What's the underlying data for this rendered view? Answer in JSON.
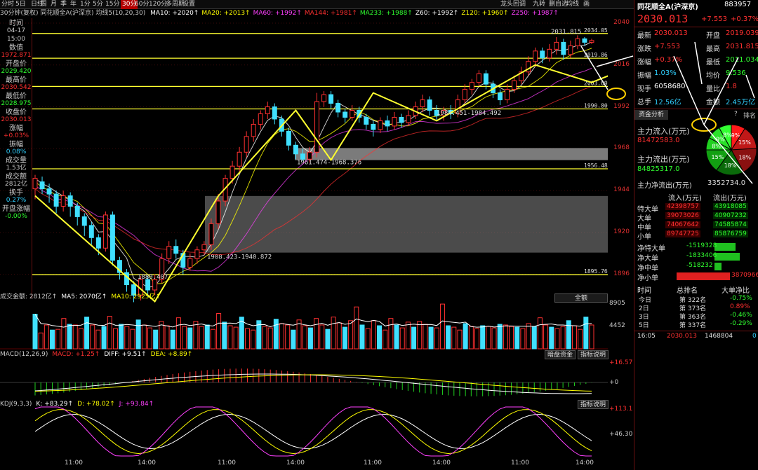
{
  "toolbar": {
    "items": [
      {
        "label": "分时",
        "active": false
      },
      {
        "label": "5日",
        "active": false
      },
      {
        "label": "日线",
        "active": false
      },
      {
        "label": "周",
        "active": false
      },
      {
        "label": "月",
        "active": false
      },
      {
        "label": "季",
        "active": false
      },
      {
        "label": "年",
        "active": false
      },
      {
        "label": "1分",
        "active": false
      },
      {
        "label": "5分",
        "active": false
      },
      {
        "label": "15分",
        "active": false
      },
      {
        "label": "30分",
        "active": true
      },
      {
        "label": "60分",
        "active": false
      },
      {
        "label": "120分",
        "active": false
      },
      {
        "label": "多周期",
        "active": false
      },
      {
        "label": "设置",
        "active": false
      }
    ],
    "right_items": [
      "龙头回调",
      "九转",
      "删自选",
      "均线",
      "画"
    ]
  },
  "ma_legend": {
    "title": "30分钟(复权) 同花顺全A(沪深京) 均线5(10,20,30)",
    "items": [
      {
        "text": "MA10: +2020↑",
        "color": "#ffffff"
      },
      {
        "text": "MA20: +2013↑",
        "color": "#ffff00"
      },
      {
        "text": "MA60: +1992↑",
        "color": "#ff40ff"
      },
      {
        "text": "MA144: +1981↑",
        "color": "#ff3030"
      },
      {
        "text": "MA233: +1988↑",
        "color": "#30ff30"
      },
      {
        "text": "Z60: +1992↑",
        "color": "#ffffff"
      },
      {
        "text": "Z120: +1960↑",
        "color": "#ffff00"
      },
      {
        "text": "Z250: +1987↑",
        "color": "#ff40ff"
      }
    ]
  },
  "left_panel": [
    {
      "label": "时间",
      "value": "04-17",
      "color": "#c8c8c8"
    },
    {
      "label": "",
      "value": "15:00",
      "color": "#c8c8c8"
    },
    {
      "label": "数值",
      "value": "1972.871",
      "color": "#ff3030"
    },
    {
      "label": "开盘价",
      "value": "2029.420",
      "color": "#30ff30"
    },
    {
      "label": "最高价",
      "value": "2030.542",
      "color": "#ff3030"
    },
    {
      "label": "最低价",
      "value": "2028.975",
      "color": "#30ff30"
    },
    {
      "label": "收盘价",
      "value": "2030.013",
      "color": "#ff3030"
    },
    {
      "label": "涨幅",
      "value": "+0.03%",
      "color": "#ff3030"
    },
    {
      "label": "振幅",
      "value": "0.08%",
      "color": "#30d0ff"
    },
    {
      "label": "成交量",
      "value": "1.53亿",
      "color": "#c8c8c8"
    },
    {
      "label": "成交额",
      "value": "2812亿",
      "color": "#c8c8c8"
    },
    {
      "label": "换手",
      "value": "0.27%",
      "color": "#30d0ff"
    },
    {
      "label": "开盘涨幅",
      "value": "-0.00%",
      "color": "#30ff30"
    }
  ],
  "price_axis": {
    "ylim": [
      1887,
      2042
    ],
    "ticks": [
      2040,
      2016,
      1992,
      1968,
      1944,
      1920,
      1896
    ]
  },
  "chart_data": {
    "type": "candlestick",
    "title": "同花顺全A(沪深京) 30分钟",
    "ylim": [
      1887,
      2042
    ],
    "candles": [
      [
        1945,
        1951,
        1939,
        1953
      ],
      [
        1949,
        1945,
        1942,
        1952
      ],
      [
        1945,
        1942,
        1937,
        1948
      ],
      [
        1942,
        1935,
        1931,
        1944
      ],
      [
        1935,
        1941,
        1932,
        1944
      ],
      [
        1941,
        1935,
        1929,
        1943
      ],
      [
        1935,
        1929,
        1924,
        1937
      ],
      [
        1929,
        1924,
        1918,
        1931
      ],
      [
        1924,
        1917,
        1913,
        1926
      ],
      [
        1917,
        1911,
        1907,
        1919
      ],
      [
        1911,
        1930,
        1909,
        1932
      ],
      [
        1930,
        1904,
        1901,
        1932
      ],
      [
        1904,
        1897,
        1893,
        1906
      ],
      [
        1897,
        1890,
        1886,
        1899
      ],
      [
        1890,
        1884,
        1880,
        1892
      ],
      [
        1884,
        1893,
        1881,
        1895
      ],
      [
        1893,
        1887,
        1883,
        1895
      ],
      [
        1887,
        1893,
        1884,
        1896
      ],
      [
        1893,
        1905,
        1891,
        1908
      ],
      [
        1905,
        1912,
        1902,
        1915
      ],
      [
        1912,
        1908,
        1905,
        1916
      ],
      [
        1908,
        1900,
        1896,
        1910
      ],
      [
        1900,
        1905,
        1898,
        1908
      ],
      [
        1905,
        1910,
        1902,
        1912
      ],
      [
        1910,
        1913,
        1907,
        1915
      ],
      [
        1913,
        1925,
        1910,
        1928
      ],
      [
        1925,
        1938,
        1922,
        1942
      ],
      [
        1938,
        1951,
        1935,
        1953
      ],
      [
        1951,
        1958,
        1948,
        1961
      ],
      [
        1958,
        1966,
        1955,
        1969
      ],
      [
        1966,
        1975,
        1963,
        1978
      ],
      [
        1975,
        1982,
        1972,
        1985
      ],
      [
        1982,
        1988,
        1979,
        1990
      ],
      [
        1988,
        1992,
        1985,
        1995
      ],
      [
        1992,
        1985,
        1982,
        1994
      ],
      [
        1985,
        1978,
        1975,
        1987
      ],
      [
        1978,
        1970,
        1967,
        1980
      ],
      [
        1970,
        1965,
        1962,
        1972
      ],
      [
        1965,
        1962,
        1961,
        1968
      ],
      [
        1962,
        1966,
        1960,
        1969
      ],
      [
        1966,
        1995,
        1963,
        2000
      ],
      [
        1995,
        1999,
        1992,
        2001
      ],
      [
        1999,
        1994,
        1991,
        2001
      ],
      [
        1994,
        1989,
        1986,
        1996
      ],
      [
        1989,
        1986,
        1983,
        1991
      ],
      [
        1986,
        1990,
        1984,
        1993
      ],
      [
        1990,
        1986,
        1983,
        1992
      ],
      [
        1986,
        1982,
        1979,
        1988
      ],
      [
        1982,
        1979,
        1975,
        1984
      ],
      [
        1979,
        1984,
        1977,
        1986
      ],
      [
        1984,
        1981,
        1978,
        1987
      ],
      [
        1981,
        1986,
        1979,
        1989
      ],
      [
        1986,
        1983,
        1980,
        1988
      ],
      [
        1983,
        1987,
        1981,
        1990
      ],
      [
        1987,
        1992,
        1985,
        1995
      ],
      [
        1992,
        1996,
        1989,
        1999
      ],
      [
        1996,
        1990,
        1987,
        1998
      ],
      [
        1990,
        1987,
        1984,
        1993
      ],
      [
        1987,
        1990,
        1984,
        1992
      ],
      [
        1990,
        1988,
        1985,
        1993
      ],
      [
        1988,
        1996,
        1986,
        1999
      ],
      [
        1996,
        2002,
        1994,
        2005
      ],
      [
        2002,
        2006,
        1999,
        2008
      ],
      [
        2006,
        2011,
        2004,
        2013
      ],
      [
        2011,
        2005,
        2002,
        2013
      ],
      [
        2005,
        2000,
        1997,
        2007
      ],
      [
        2000,
        1996,
        1993,
        2002
      ],
      [
        1996,
        2002,
        1994,
        2005
      ],
      [
        2002,
        2007,
        2000,
        2010
      ],
      [
        2007,
        2012,
        2005,
        2015
      ],
      [
        2012,
        2018,
        2010,
        2021
      ],
      [
        2018,
        2024,
        2015,
        2026
      ],
      [
        2024,
        2020,
        2017,
        2026
      ],
      [
        2020,
        2025,
        2018,
        2028
      ],
      [
        2025,
        2029,
        2022,
        2032
      ],
      [
        2029,
        2022,
        2019,
        2031
      ],
      [
        2022,
        2027,
        2020,
        2030
      ],
      [
        2027,
        2031,
        2025,
        2033
      ],
      [
        2031,
        2029,
        2027,
        2032
      ],
      [
        2029,
        2030,
        2028,
        2031
      ]
    ],
    "zigzag": [
      [
        0,
        1941
      ],
      [
        17,
        1880.407
      ],
      [
        26,
        1940.872
      ],
      [
        37,
        1990
      ],
      [
        42,
        1961.474
      ],
      [
        48,
        2000
      ],
      [
        57,
        1984
      ],
      [
        71,
        2016
      ],
      [
        79,
        2006
      ],
      [
        95,
        2031.815
      ]
    ],
    "hlines": [
      {
        "value": 2034.05,
        "label": "2034.050"
      },
      {
        "value": 2019.86,
        "label": "2019.860"
      },
      {
        "value": 2003.69,
        "label": "2003.690"
      },
      {
        "value": 1990.8,
        "label": "1990.800"
      },
      {
        "value": 1956.48,
        "label": "1956.480"
      },
      {
        "value": 1895.76,
        "label": "1895.760"
      }
    ],
    "boxes": [
      {
        "from": 1961.474,
        "to": 1968.376,
        "label": "1961.474-1968.376"
      },
      {
        "from": 1908.423,
        "to": 1940.872,
        "label": "1908.423-1940.872"
      }
    ],
    "annotations": [
      "1984.451-1984.492",
      "2031.815",
      "1880.407"
    ]
  },
  "volume": {
    "legend": [
      {
        "text": "成交金额: 2812亿↑",
        "color": "#c8c8c8"
      },
      {
        "text": "MA5: 2070亿↑",
        "color": "#ffffff"
      },
      {
        "text": "MA10: 2925亿↑",
        "color": "#ffff00"
      }
    ],
    "button": "全额",
    "ticks": [
      "8905",
      "4452"
    ],
    "values": [
      4800,
      2200,
      3300,
      2600,
      2700,
      4200,
      3400,
      3300,
      2800,
      4400,
      3300,
      2600,
      3100,
      4500,
      2800,
      3400,
      3100,
      2700,
      4000,
      3300,
      2900,
      2600,
      3800,
      3200,
      2600,
      4300,
      3100,
      2900,
      3800,
      3100,
      3300,
      2700,
      4900,
      3700,
      3200,
      3000,
      4400,
      2800,
      2600,
      3900,
      3100,
      2900,
      4100,
      3500,
      3300,
      2600,
      4000,
      3200,
      2900,
      4200,
      3300,
      2700,
      4400,
      3600,
      3000,
      3900,
      5800,
      3300,
      2800,
      3900,
      3200,
      2600,
      4200,
      3300,
      2900,
      3700,
      3000,
      3800,
      3400,
      3000,
      2900,
      6200,
      3200,
      3000,
      2600,
      3500,
      3100,
      2800,
      3200,
      3100,
      2900,
      3400,
      3300,
      3100,
      3000,
      2800,
      3500,
      3100,
      4300,
      3300,
      3000,
      2800,
      3100,
      3900,
      3200,
      2700,
      4400,
      3300
    ]
  },
  "macd": {
    "legend": [
      {
        "text": "MACD(12,26,9)",
        "color": "#c8c8c8"
      },
      {
        "text": "MACD: +1.25↑",
        "color": "#ff3030"
      },
      {
        "text": "DIFF: +9.51↑",
        "color": "#ffffff"
      },
      {
        "text": "DEA: +8.89↑",
        "color": "#ffff00"
      }
    ],
    "buttons": [
      "暗盘资金",
      "指标说明"
    ],
    "ticks": [
      "+16.57",
      "+0"
    ]
  },
  "kdj": {
    "legend": [
      {
        "text": "KDJ(9,3,3)",
        "color": "#c8c8c8"
      },
      {
        "text": "K: +83.29↑",
        "color": "#ffffff"
      },
      {
        "text": "D: +78.02↑",
        "color": "#ffff00"
      },
      {
        "text": "J: +93.84↑",
        "color": "#ff40ff"
      }
    ],
    "button": "指标说明",
    "ticks": [
      "+113.1",
      "+46.30"
    ]
  },
  "x_axis": [
    "11:00",
    "14:00",
    "11:00",
    "14:00",
    "11:00",
    "14:00",
    "11:00",
    "14:00"
  ],
  "quote": {
    "name": "同花顺全A(沪深京)",
    "code": "883957",
    "price": "2030.013",
    "change": "+7.553",
    "pct": "+0.37%",
    "rows": [
      {
        "l1": "最新",
        "v1": "2030.013",
        "c1": "#ff3030",
        "l2": "开盘",
        "v2": "2019.039",
        "c2": "#ff3030"
      },
      {
        "l1": "涨跌",
        "v1": "+7.553",
        "c1": "#ff3030",
        "l2": "最高",
        "v2": "2031.815",
        "c2": "#ff3030"
      },
      {
        "l1": "涨幅",
        "v1": "+0.37%",
        "c1": "#ff3030",
        "l2": "最低",
        "v2": "2011.034",
        "c2": "#30ff30"
      },
      {
        "l1": "振幅",
        "v1": "1.03%",
        "c1": "#30d0ff",
        "l2": "均价",
        "v2": "9.536",
        "c2": "#30ff30"
      },
      {
        "l1": "现手",
        "v1": "6058680",
        "c1": "#ffffff",
        "l2": "量比",
        "v2": "1.8",
        "c2": "#ff3030"
      },
      {
        "l1": "总手",
        "v1": "12.56亿",
        "c1": "#30d0ff",
        "l2": "金额",
        "v2": "2.45万亿",
        "c2": "#30d0ff"
      }
    ]
  },
  "fund": {
    "tab": "资金分析",
    "help": "?",
    "rank_tab": "排名",
    "inflow_label": "主力流入(万元)",
    "inflow_value": "81472583.0",
    "outflow_label": "主力流出(万元)",
    "outflow_value": "84825317.0",
    "net_label": "主力净流出(万元)",
    "net_value": "3352734.0",
    "pie": [
      {
        "label": "9%",
        "value": 9,
        "color": "#ff1a1a"
      },
      {
        "label": "15%",
        "value": 15,
        "color": "#c01818"
      },
      {
        "label": "18%",
        "value": 18,
        "color": "#8a1010"
      },
      {
        "label": "18%",
        "value": 18,
        "color": "#0a6a0a"
      },
      {
        "label": "15%",
        "value": 15,
        "color": "#12a012"
      },
      {
        "label": "8%",
        "value": 8,
        "color": "#20d020"
      },
      {
        "label": "9%",
        "value": 9,
        "color": "#2ae02a"
      },
      {
        "label": "8%",
        "value": 8,
        "color": "#33ff33"
      }
    ],
    "flow_header": [
      "流入(万元)",
      "流出(万元)"
    ],
    "flow_rows": [
      {
        "name": "特大单",
        "in": "42398757",
        "out": "43918085"
      },
      {
        "name": "大单",
        "in": "39073026",
        "out": "40907232"
      },
      {
        "name": "中单",
        "in": "74067642",
        "out": "74585874"
      },
      {
        "name": "小单",
        "in": "89747725",
        "out": "85876759"
      }
    ],
    "net_rows": [
      {
        "name": "净特大单",
        "value": "-1519328",
        "amount": -1519328
      },
      {
        "name": "净大单",
        "value": "-1833406",
        "amount": -1833406
      },
      {
        "name": "净中单",
        "value": "-518232",
        "amount": -518232
      },
      {
        "name": "净小单",
        "value": "3870966",
        "amount": 3870966
      }
    ],
    "rank_header": [
      "时间",
      "总排名",
      "大单净比"
    ],
    "rank_rows": [
      {
        "t": "今日",
        "r": "第 322名",
        "p": "-0.75%",
        "c": "#30ff30"
      },
      {
        "t": "2日",
        "r": "第 373名",
        "p": "0.89%",
        "c": "#ff3030"
      },
      {
        "t": "3日",
        "r": "第 363名",
        "p": "-0.46%",
        "c": "#30ff30"
      },
      {
        "t": "5日",
        "r": "第 337名",
        "p": "-0.29%",
        "c": "#30ff30"
      }
    ],
    "tick": {
      "time": "16:05",
      "price": "2030.013",
      "vol": "1468804",
      "extra": "0"
    }
  }
}
